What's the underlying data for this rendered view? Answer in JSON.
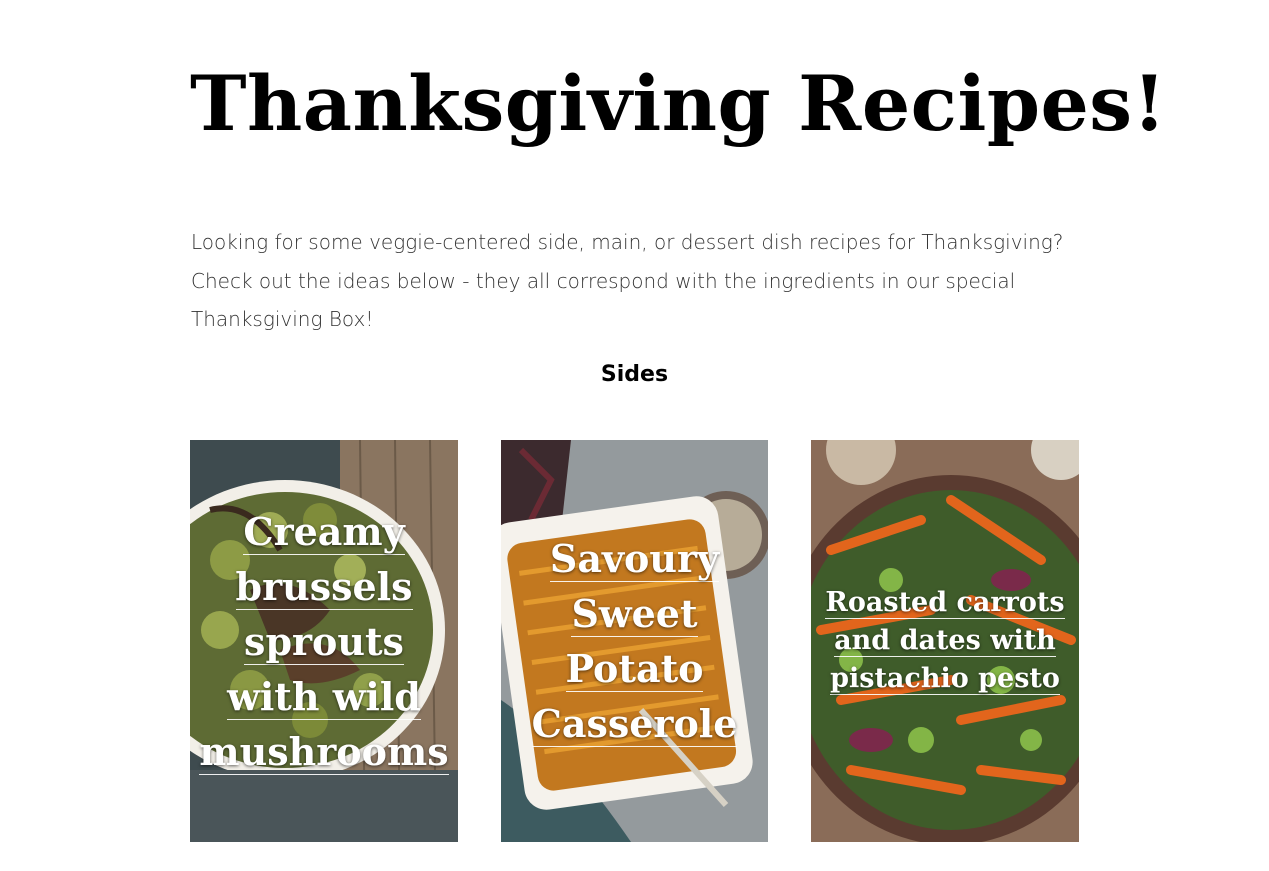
{
  "page": {
    "title": "Thanksgiving Recipes!",
    "intro_lines": [
      "Looking for some veggie-centered side, main, or dessert dish recipes for Thanksgiving?",
      "Check out the ideas below - they all correspond with the ingredients in our special",
      "Thanksgiving Box!"
    ],
    "section_heading": "Sides"
  },
  "cards": [
    {
      "title": "Creamy brussels sprouts with wild mushrooms"
    },
    {
      "title": "Savoury Sweet Potato Casserole"
    },
    {
      "title": "Roasted carrots and dates with pistachio pesto"
    }
  ]
}
